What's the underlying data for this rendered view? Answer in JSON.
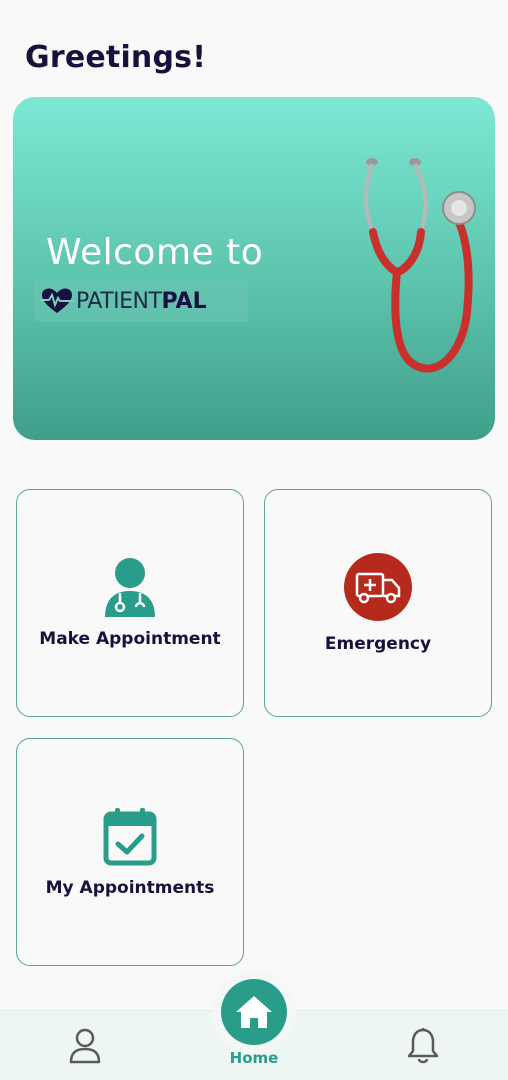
{
  "header": {
    "title": "Greetings!"
  },
  "banner": {
    "welcome_text": "Welcome to",
    "logo_text_light": "PATIENT",
    "logo_text_bold": "PAL"
  },
  "cards": [
    {
      "label": "Make Appointment",
      "icon": "doctor-icon"
    },
    {
      "label": "Emergency",
      "icon": "ambulance-icon"
    },
    {
      "label": "My Appointments",
      "icon": "calendar-check-icon"
    }
  ],
  "bottom_nav": {
    "home_label": "Home",
    "items": [
      "profile-icon",
      "home-icon",
      "bell-icon"
    ]
  },
  "colors": {
    "accent": "#2a9d8a",
    "emergency": "#b52a1c",
    "text_dark": "#1b0f3d"
  }
}
